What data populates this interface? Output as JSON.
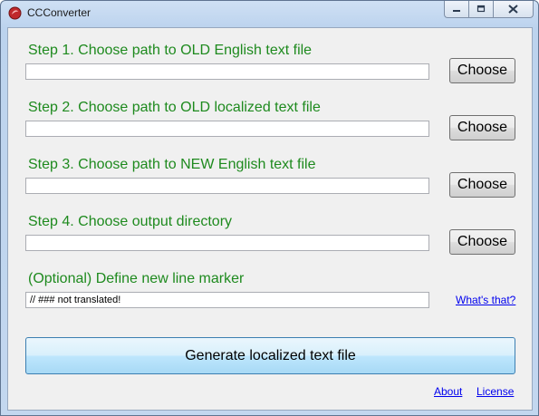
{
  "window": {
    "title": "CCConverter",
    "icon": "ccconverter-app-icon",
    "caption_buttons": [
      "minimize-icon",
      "maximize-icon",
      "close-icon"
    ]
  },
  "steps": [
    {
      "label": "Step 1. Choose path to OLD English text file",
      "value": "",
      "button": "Choose"
    },
    {
      "label": "Step 2. Choose path to OLD localized text file",
      "value": "",
      "button": "Choose"
    },
    {
      "label": "Step 3. Choose path to NEW English text file",
      "value": "",
      "button": "Choose"
    },
    {
      "label": "Step 4. Choose output directory",
      "value": "",
      "button": "Choose"
    }
  ],
  "marker": {
    "label": "(Optional) Define new line marker",
    "value": "// ### not translated!",
    "help_link": "What's that?"
  },
  "generate_button": "Generate localized text file",
  "footer": {
    "about_link": "About",
    "license_link": "License"
  },
  "colors": {
    "label_green": "#1e8a1e",
    "link_blue": "#0000ee",
    "client_bg": "#f0f0f0"
  }
}
